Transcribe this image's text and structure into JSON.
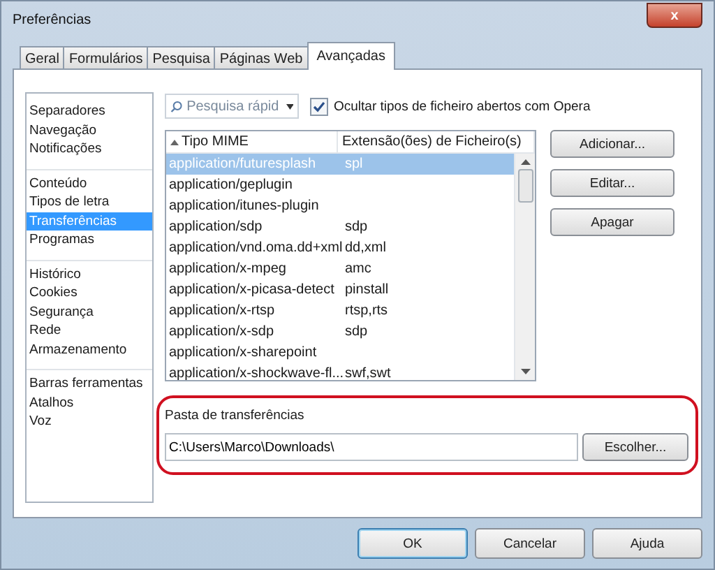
{
  "window": {
    "title": "Preferências",
    "close_label": "x"
  },
  "tabs": [
    {
      "label": "Geral",
      "selected": false
    },
    {
      "label": "Formulários",
      "selected": false
    },
    {
      "label": "Pesquisa",
      "selected": false
    },
    {
      "label": "Páginas Web",
      "selected": false
    },
    {
      "label": "Avançadas",
      "selected": true
    }
  ],
  "sidebar": {
    "groups": [
      {
        "items": [
          {
            "label": "Separadores",
            "selected": false
          },
          {
            "label": "Navegação",
            "selected": false
          },
          {
            "label": "Notificações",
            "selected": false
          }
        ]
      },
      {
        "items": [
          {
            "label": "Conteúdo",
            "selected": false
          },
          {
            "label": "Tipos de letra",
            "selected": false
          },
          {
            "label": "Transferências",
            "selected": true
          },
          {
            "label": "Programas",
            "selected": false
          }
        ]
      },
      {
        "items": [
          {
            "label": "Histórico",
            "selected": false
          },
          {
            "label": "Cookies",
            "selected": false
          },
          {
            "label": "Segurança",
            "selected": false
          },
          {
            "label": "Rede",
            "selected": false
          },
          {
            "label": "Armazenamento",
            "selected": false
          }
        ]
      },
      {
        "items": [
          {
            "label": "Barras ferramentas",
            "selected": false
          },
          {
            "label": "Atalhos",
            "selected": false
          },
          {
            "label": "Voz",
            "selected": false
          }
        ]
      }
    ]
  },
  "search": {
    "placeholder": "Pesquisa rápid"
  },
  "hide_option": {
    "label": "Ocultar tipos de ficheiro abertos com Opera",
    "checked": true
  },
  "table": {
    "columns": [
      "Tipo MIME",
      "Extensão(ões) de Ficheiro(s)"
    ],
    "rows": [
      {
        "cells": [
          "application/futuresplash",
          "spl"
        ],
        "selected": true
      },
      {
        "cells": [
          "application/geplugin",
          ""
        ],
        "selected": false
      },
      {
        "cells": [
          "application/itunes-plugin",
          ""
        ],
        "selected": false
      },
      {
        "cells": [
          "application/sdp",
          "sdp"
        ],
        "selected": false
      },
      {
        "cells": [
          "application/vnd.oma.dd+xml",
          "dd,xml"
        ],
        "selected": false
      },
      {
        "cells": [
          "application/x-mpeg",
          "amc"
        ],
        "selected": false
      },
      {
        "cells": [
          "application/x-picasa-detect",
          "pinstall"
        ],
        "selected": false
      },
      {
        "cells": [
          "application/x-rtsp",
          "rtsp,rts"
        ],
        "selected": false
      },
      {
        "cells": [
          "application/x-sdp",
          "sdp"
        ],
        "selected": false
      },
      {
        "cells": [
          "application/x-sharepoint",
          ""
        ],
        "selected": false
      },
      {
        "cells": [
          "application/x-shockwave-fl...",
          "swf,swt"
        ],
        "selected": false
      }
    ]
  },
  "side_buttons": [
    "Adicionar...",
    "Editar...",
    "Apagar"
  ],
  "download_folder": {
    "label": "Pasta de transferências",
    "value": "C:\\Users\\Marco\\Downloads\\",
    "button": "Escolher..."
  },
  "buttons": [
    {
      "label": "OK",
      "default": true
    },
    {
      "label": "Cancelar",
      "default": false
    },
    {
      "label": "Ajuda",
      "default": false
    }
  ]
}
